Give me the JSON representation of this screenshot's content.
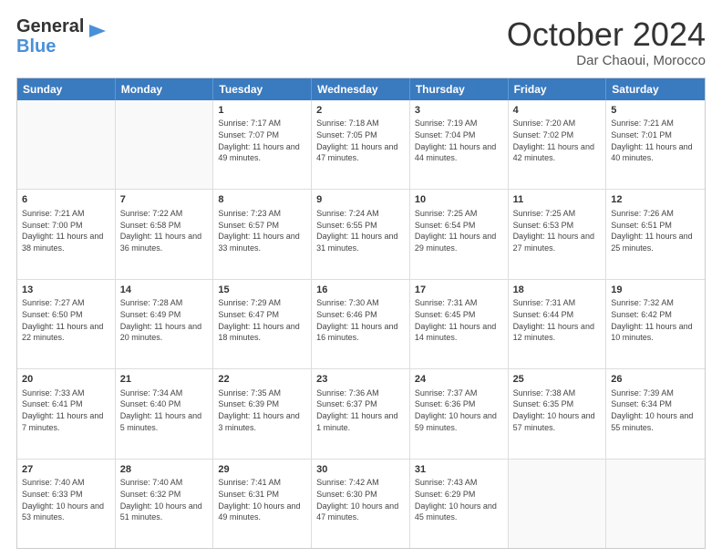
{
  "header": {
    "logo_line1": "General",
    "logo_line2": "Blue",
    "month": "October 2024",
    "location": "Dar Chaoui, Morocco"
  },
  "days": [
    "Sunday",
    "Monday",
    "Tuesday",
    "Wednesday",
    "Thursday",
    "Friday",
    "Saturday"
  ],
  "weeks": [
    [
      {
        "day": "",
        "info": ""
      },
      {
        "day": "",
        "info": ""
      },
      {
        "day": "1",
        "info": "Sunrise: 7:17 AM\nSunset: 7:07 PM\nDaylight: 11 hours and 49 minutes."
      },
      {
        "day": "2",
        "info": "Sunrise: 7:18 AM\nSunset: 7:05 PM\nDaylight: 11 hours and 47 minutes."
      },
      {
        "day": "3",
        "info": "Sunrise: 7:19 AM\nSunset: 7:04 PM\nDaylight: 11 hours and 44 minutes."
      },
      {
        "day": "4",
        "info": "Sunrise: 7:20 AM\nSunset: 7:02 PM\nDaylight: 11 hours and 42 minutes."
      },
      {
        "day": "5",
        "info": "Sunrise: 7:21 AM\nSunset: 7:01 PM\nDaylight: 11 hours and 40 minutes."
      }
    ],
    [
      {
        "day": "6",
        "info": "Sunrise: 7:21 AM\nSunset: 7:00 PM\nDaylight: 11 hours and 38 minutes."
      },
      {
        "day": "7",
        "info": "Sunrise: 7:22 AM\nSunset: 6:58 PM\nDaylight: 11 hours and 36 minutes."
      },
      {
        "day": "8",
        "info": "Sunrise: 7:23 AM\nSunset: 6:57 PM\nDaylight: 11 hours and 33 minutes."
      },
      {
        "day": "9",
        "info": "Sunrise: 7:24 AM\nSunset: 6:55 PM\nDaylight: 11 hours and 31 minutes."
      },
      {
        "day": "10",
        "info": "Sunrise: 7:25 AM\nSunset: 6:54 PM\nDaylight: 11 hours and 29 minutes."
      },
      {
        "day": "11",
        "info": "Sunrise: 7:25 AM\nSunset: 6:53 PM\nDaylight: 11 hours and 27 minutes."
      },
      {
        "day": "12",
        "info": "Sunrise: 7:26 AM\nSunset: 6:51 PM\nDaylight: 11 hours and 25 minutes."
      }
    ],
    [
      {
        "day": "13",
        "info": "Sunrise: 7:27 AM\nSunset: 6:50 PM\nDaylight: 11 hours and 22 minutes."
      },
      {
        "day": "14",
        "info": "Sunrise: 7:28 AM\nSunset: 6:49 PM\nDaylight: 11 hours and 20 minutes."
      },
      {
        "day": "15",
        "info": "Sunrise: 7:29 AM\nSunset: 6:47 PM\nDaylight: 11 hours and 18 minutes."
      },
      {
        "day": "16",
        "info": "Sunrise: 7:30 AM\nSunset: 6:46 PM\nDaylight: 11 hours and 16 minutes."
      },
      {
        "day": "17",
        "info": "Sunrise: 7:31 AM\nSunset: 6:45 PM\nDaylight: 11 hours and 14 minutes."
      },
      {
        "day": "18",
        "info": "Sunrise: 7:31 AM\nSunset: 6:44 PM\nDaylight: 11 hours and 12 minutes."
      },
      {
        "day": "19",
        "info": "Sunrise: 7:32 AM\nSunset: 6:42 PM\nDaylight: 11 hours and 10 minutes."
      }
    ],
    [
      {
        "day": "20",
        "info": "Sunrise: 7:33 AM\nSunset: 6:41 PM\nDaylight: 11 hours and 7 minutes."
      },
      {
        "day": "21",
        "info": "Sunrise: 7:34 AM\nSunset: 6:40 PM\nDaylight: 11 hours and 5 minutes."
      },
      {
        "day": "22",
        "info": "Sunrise: 7:35 AM\nSunset: 6:39 PM\nDaylight: 11 hours and 3 minutes."
      },
      {
        "day": "23",
        "info": "Sunrise: 7:36 AM\nSunset: 6:37 PM\nDaylight: 11 hours and 1 minute."
      },
      {
        "day": "24",
        "info": "Sunrise: 7:37 AM\nSunset: 6:36 PM\nDaylight: 10 hours and 59 minutes."
      },
      {
        "day": "25",
        "info": "Sunrise: 7:38 AM\nSunset: 6:35 PM\nDaylight: 10 hours and 57 minutes."
      },
      {
        "day": "26",
        "info": "Sunrise: 7:39 AM\nSunset: 6:34 PM\nDaylight: 10 hours and 55 minutes."
      }
    ],
    [
      {
        "day": "27",
        "info": "Sunrise: 7:40 AM\nSunset: 6:33 PM\nDaylight: 10 hours and 53 minutes."
      },
      {
        "day": "28",
        "info": "Sunrise: 7:40 AM\nSunset: 6:32 PM\nDaylight: 10 hours and 51 minutes."
      },
      {
        "day": "29",
        "info": "Sunrise: 7:41 AM\nSunset: 6:31 PM\nDaylight: 10 hours and 49 minutes."
      },
      {
        "day": "30",
        "info": "Sunrise: 7:42 AM\nSunset: 6:30 PM\nDaylight: 10 hours and 47 minutes."
      },
      {
        "day": "31",
        "info": "Sunrise: 7:43 AM\nSunset: 6:29 PM\nDaylight: 10 hours and 45 minutes."
      },
      {
        "day": "",
        "info": ""
      },
      {
        "day": "",
        "info": ""
      }
    ]
  ]
}
